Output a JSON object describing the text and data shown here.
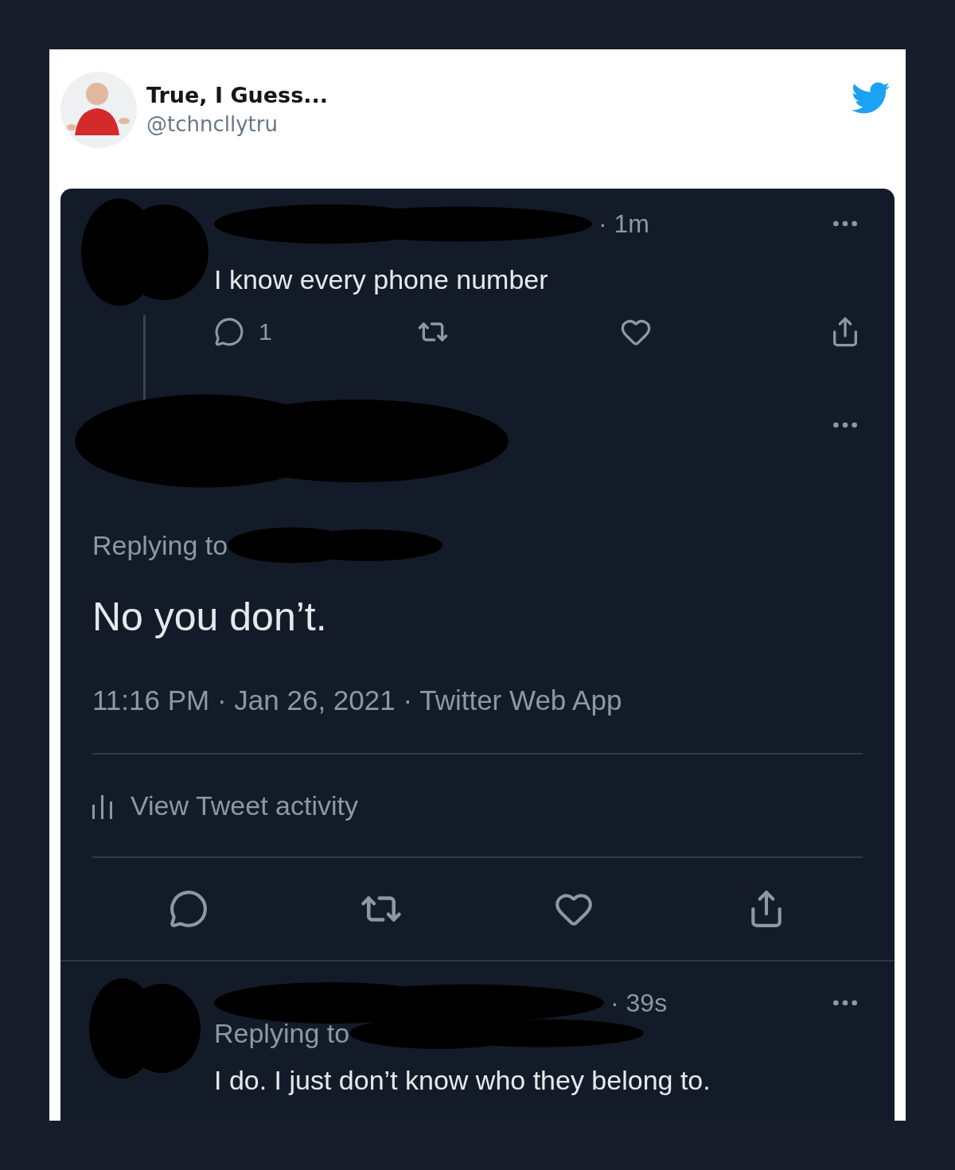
{
  "header": {
    "name": "True, I Guess...",
    "handle": "@tchncllytru"
  },
  "parent_tweet": {
    "time": "· 1m",
    "text": "I know every phone number",
    "reply_count": "1"
  },
  "main_tweet": {
    "replying_label": "Replying to",
    "text": "No you don’t.",
    "meta": "11:16 PM · Jan 26, 2021 · Twitter Web App",
    "activity_link": "View Tweet activity"
  },
  "reply_tweet": {
    "time": "· 39s",
    "replying_label": "Replying to",
    "text": "I do. I just don’t know who they belong to."
  }
}
